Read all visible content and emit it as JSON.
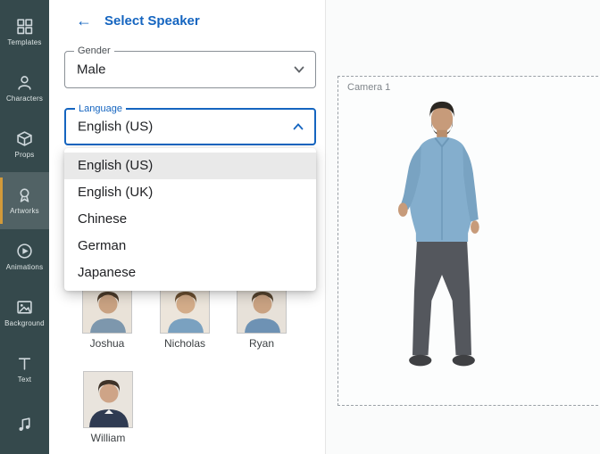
{
  "colors": {
    "accent_blue": "#1565C0",
    "sidebar_bg": "#35494C",
    "sidebar_active_accent": "#D29A3A",
    "menu_selected_bg": "#E9E9E9",
    "shirt_blue": "#84AECD"
  },
  "sidebar": {
    "items": [
      {
        "label": "Templates"
      },
      {
        "label": "Characters"
      },
      {
        "label": "Props"
      },
      {
        "label": "Artworks"
      },
      {
        "label": "Animations"
      },
      {
        "label": "Background"
      },
      {
        "label": "Text"
      },
      {
        "label": ""
      }
    ]
  },
  "panel": {
    "back_icon": "←",
    "title": "Select Speaker",
    "gender_field": {
      "label": "Gender",
      "value": "Male"
    },
    "language_field": {
      "label": "Language",
      "value": "English (US)"
    },
    "language_menu": {
      "options": [
        {
          "label": "English (US)",
          "selected": true
        },
        {
          "label": "English (UK)",
          "selected": false
        },
        {
          "label": "Chinese",
          "selected": false
        },
        {
          "label": "German",
          "selected": false
        },
        {
          "label": "Japanese",
          "selected": false
        }
      ]
    },
    "speakers": [
      {
        "name": "Joshua"
      },
      {
        "name": "Nicholas"
      },
      {
        "name": "Ryan"
      },
      {
        "name": "William"
      }
    ]
  },
  "canvas": {
    "camera_label": "Camera 1"
  }
}
